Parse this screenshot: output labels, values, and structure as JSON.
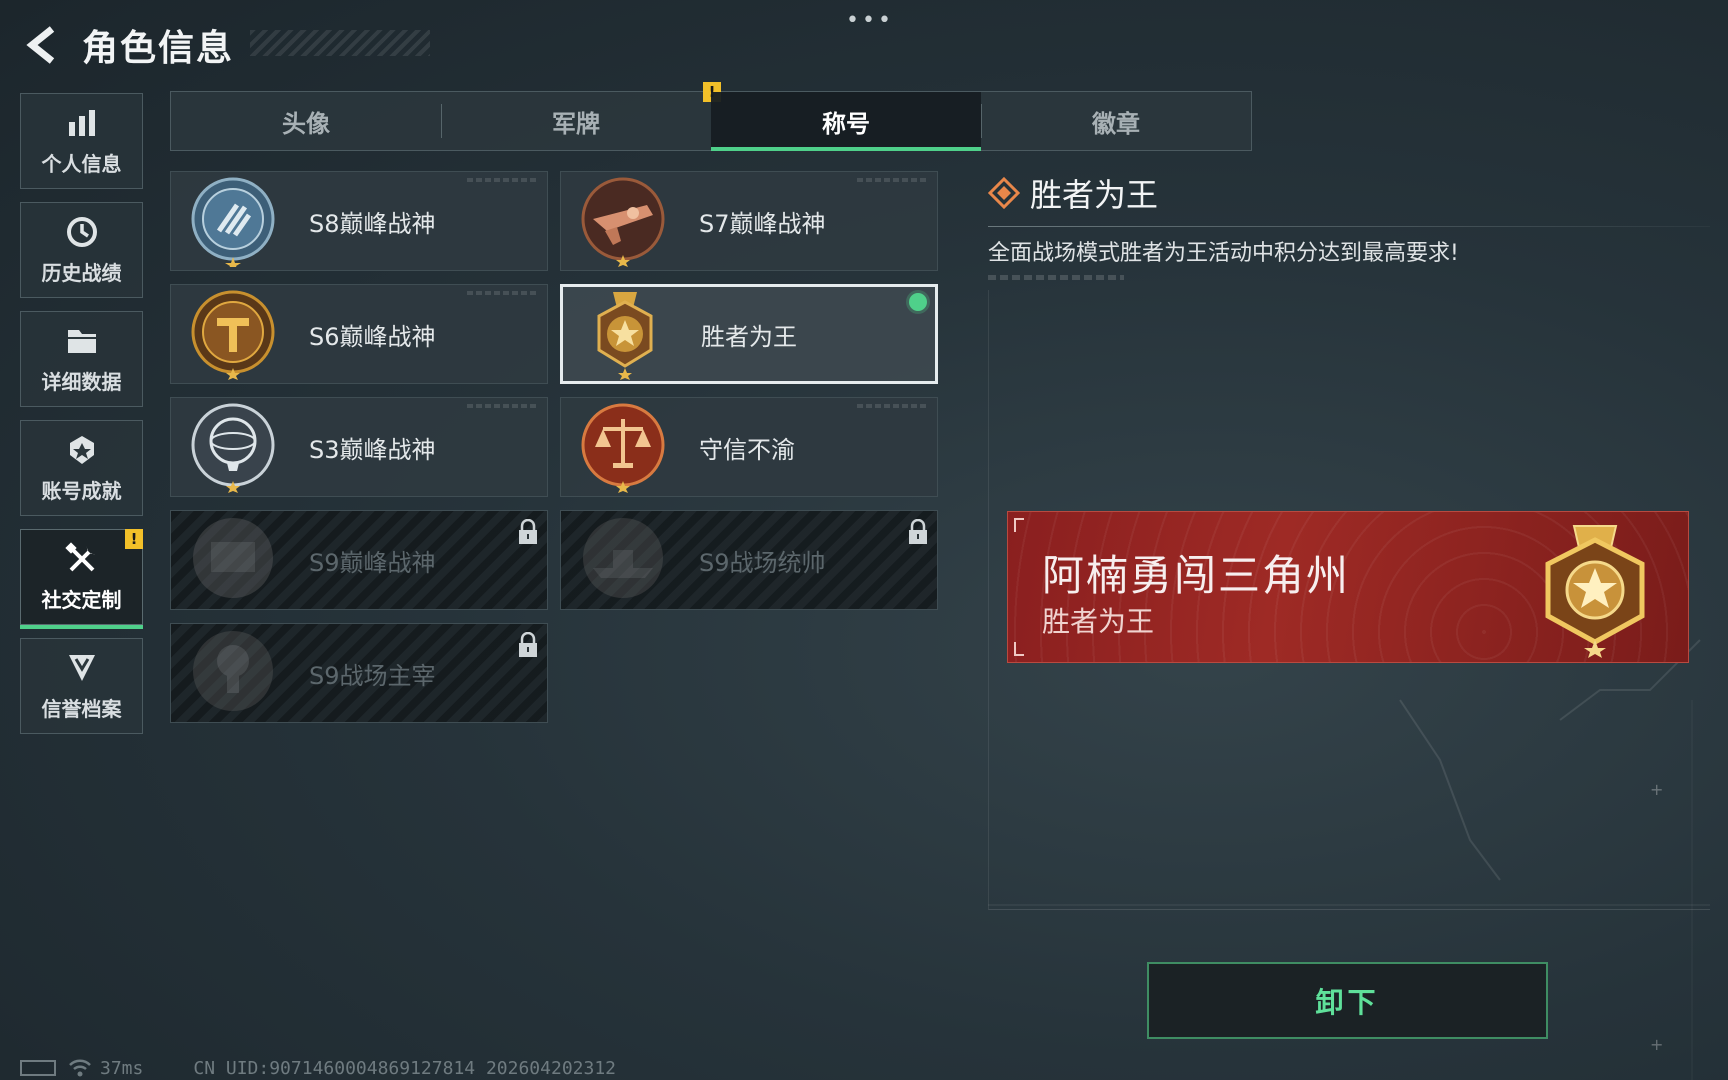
{
  "header": {
    "title": "角色信息",
    "back_icon": "chevron-left-icon"
  },
  "sidebar": {
    "items": [
      {
        "label": "个人信息",
        "icon": "bar-chart-icon"
      },
      {
        "label": "历史战绩",
        "icon": "history-clock-icon"
      },
      {
        "label": "详细数据",
        "icon": "folder-icon"
      },
      {
        "label": "账号成就",
        "icon": "achievement-badge-icon"
      },
      {
        "label": "社交定制",
        "icon": "tools-icon",
        "active": true,
        "badge": "!"
      },
      {
        "label": "信誉档案",
        "icon": "shield-chevron-icon"
      }
    ]
  },
  "tabs": [
    {
      "label": "头像"
    },
    {
      "label": "军牌",
      "badge": "!"
    },
    {
      "label": "称号",
      "active": true
    },
    {
      "label": "徽章"
    }
  ],
  "titles": [
    {
      "label": "S8巅峰战神",
      "state": "owned",
      "icon": "s8-emblem-icon"
    },
    {
      "label": "S7巅峰战神",
      "state": "owned",
      "icon": "s7-emblem-icon"
    },
    {
      "label": "S6巅峰战神",
      "state": "owned",
      "icon": "s6-emblem-icon"
    },
    {
      "label": "胜者为王",
      "state": "selected-equipped",
      "icon": "victor-medal-icon"
    },
    {
      "label": "S3巅峰战神",
      "state": "owned",
      "icon": "s3-emblem-icon"
    },
    {
      "label": "守信不渝",
      "state": "owned",
      "icon": "scales-emblem-icon"
    },
    {
      "label": "S9巅峰战神",
      "state": "locked",
      "icon": "s9-peak-emblem-icon"
    },
    {
      "label": "S9战场统帅",
      "state": "locked",
      "icon": "s9-commander-emblem-icon"
    },
    {
      "label": "S9战场主宰",
      "state": "locked",
      "icon": "s9-dominator-emblem-icon"
    }
  ],
  "detail": {
    "title": "胜者为王",
    "description": "全面战场模式胜者为王活动中积分达到最高要求!",
    "icon": "diamond-title-icon"
  },
  "preview": {
    "player_name": "阿楠勇闯三角州",
    "title": "胜者为王"
  },
  "actions": {
    "unequip_label": "卸下"
  },
  "status": {
    "ping": "37ms",
    "uid": "CN UID:907146000486912781​4 202604202312"
  },
  "colors": {
    "accent_green": "#4fd08a",
    "badge_yellow": "#f2c029",
    "banner_red": "#9e2a25"
  }
}
